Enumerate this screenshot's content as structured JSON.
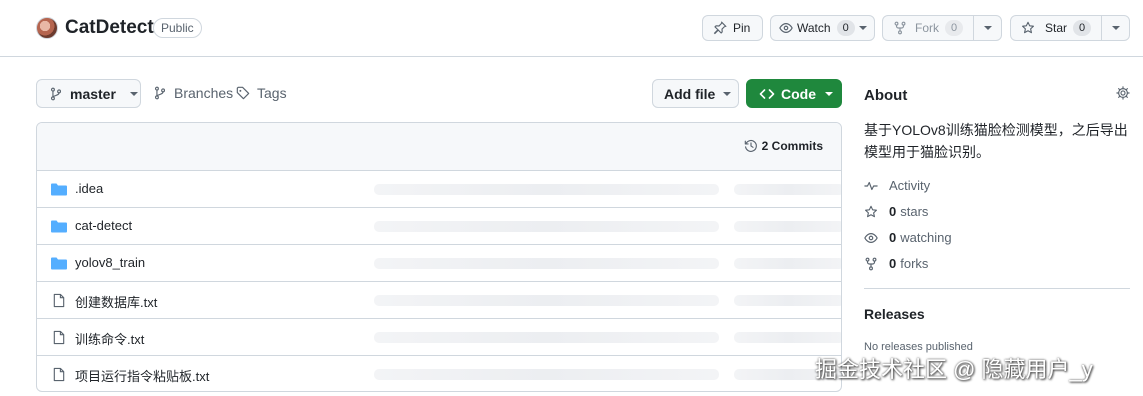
{
  "repo": {
    "name": "CatDetect",
    "visibility": "Public"
  },
  "actions": {
    "pin_label": "Pin",
    "watch_label": "Watch",
    "watch_count": "0",
    "fork_label": "Fork",
    "fork_count": "0",
    "star_label": "Star",
    "star_count": "0"
  },
  "toolbar": {
    "branch": "master",
    "branches_label": "Branches",
    "tags_label": "Tags",
    "add_file_label": "Add file",
    "code_label": "Code"
  },
  "files": {
    "commits_label": "2 Commits",
    "items": [
      {
        "name": ".idea",
        "type": "folder"
      },
      {
        "name": "cat-detect",
        "type": "folder"
      },
      {
        "name": "yolov8_train",
        "type": "folder"
      },
      {
        "name": "创建数据库.txt",
        "type": "file"
      },
      {
        "name": "训练命令.txt",
        "type": "file"
      },
      {
        "name": "项目运行指令粘贴板.txt",
        "type": "file"
      }
    ]
  },
  "about": {
    "title": "About",
    "description": "基于YOLOv8训练猫脸检测模型，之后导出模型用于猫脸识别。",
    "activity_label": "Activity",
    "stars_count": "0",
    "stars_label": "stars",
    "watching_count": "0",
    "watching_label": "watching",
    "forks_count": "0",
    "forks_label": "forks"
  },
  "releases": {
    "title": "Releases",
    "empty_text": "No releases published"
  },
  "watermark": "掘金技术社区 @ 隐藏用户_y",
  "colors": {
    "accent_green": "#1f883d",
    "folder_blue": "#54aeff",
    "border": "#d0d7de",
    "muted_text": "#59636e"
  }
}
